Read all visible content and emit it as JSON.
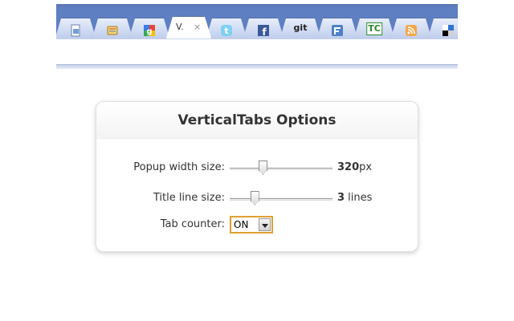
{
  "browser": {
    "tabs": [
      {
        "icon": "page-icon"
      },
      {
        "icon": "notebook-icon"
      },
      {
        "icon": "google-icon"
      },
      {
        "icon": "vertical-tabs-icon",
        "title": "V.",
        "active": true
      },
      {
        "icon": "twitter-icon"
      },
      {
        "icon": "facebook-icon"
      },
      {
        "icon": "git-icon",
        "text": "git"
      },
      {
        "icon": "friendfeed-icon"
      },
      {
        "icon": "techcrunch-icon",
        "text": "TC"
      },
      {
        "icon": "rss-icon"
      },
      {
        "icon": "delicious-icon"
      }
    ],
    "close_glyph": "×"
  },
  "options": {
    "title": "VerticalTabs Options",
    "popup_width": {
      "label": "Popup width size:",
      "value": "320",
      "unit": "px",
      "slider_fraction": 0.32
    },
    "title_lines": {
      "label": "Title line size:",
      "value": "3",
      "unit": " lines",
      "slider_fraction": 0.24
    },
    "tab_counter": {
      "label": "Tab counter:",
      "value": "ON"
    }
  },
  "colors": {
    "tabstrip": "#5f7fc3",
    "select_focus": "#e0a030"
  }
}
